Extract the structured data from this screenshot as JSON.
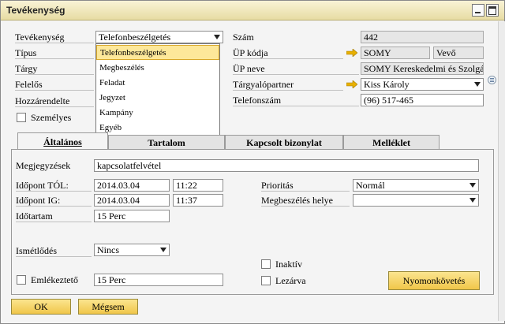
{
  "window": {
    "title": "Tevékenység"
  },
  "left_labels": {
    "tevekenyseg": "Tevékenység",
    "tipus": "Típus",
    "targy": "Tárgy",
    "felelos": "Felelős",
    "hozzarendelte": "Hozzárendelte",
    "szemelyes": "Személyes"
  },
  "activity_select": {
    "value": "Telefonbeszélgetés"
  },
  "activity_options": [
    "Telefonbeszélgetés",
    "Megbeszélés",
    "Feladat",
    "Jegyzet",
    "Kampány",
    "Egyéb"
  ],
  "right_labels": {
    "szam": "Szám",
    "up_kodja": "ÜP kódja",
    "up_neve": "ÜP neve",
    "targyalopartner": "Tárgyalópartner",
    "telefonszam": "Telefonszám"
  },
  "right_values": {
    "szam": "442",
    "up_kodja": "SOMY",
    "up_type": "Vevő",
    "up_neve": "SOMY Kereskedelmi és Szolgál",
    "targyalopartner": "Kiss Károly",
    "telefonszam": "(96) 517-465"
  },
  "tabs": [
    "Általános",
    "Tartalom",
    "Kapcsolt bizonylat",
    "Melléklet"
  ],
  "general": {
    "megjegyzesek_label": "Megjegyzések",
    "megjegyzesek_value": "kapcsolatfelvétel",
    "idopont_tol_label": "Időpont TÓL:",
    "idopont_tol_date": "2014.03.04",
    "idopont_tol_time": "11:22",
    "idopont_ig_label": "Időpont IG:",
    "idopont_ig_date": "2014.03.04",
    "idopont_ig_time": "11:37",
    "idotartam_label": "Időtartam",
    "idotartam_value": "15 Perc",
    "prioritas_label": "Prioritás",
    "prioritas_value": "Normál",
    "megbeszeles_helye_label": "Megbeszélés helye",
    "megbeszeles_helye_value": "",
    "ismetlodes_label": "Ismétlődés",
    "ismetlodes_value": "Nincs",
    "emlekezteto_label": "Emlékeztető",
    "emlekezteto_value": "15 Perc",
    "inaktiv_label": "Inaktív",
    "lezarva_label": "Lezárva",
    "nyomonkovetes_label": "Nyomonkövetés"
  },
  "footer": {
    "ok": "OK",
    "megsem": "Mégsem"
  },
  "colors": {
    "accent": "#f0c64a",
    "title_bar": "#efe6b6",
    "selected_item": "#fde89a",
    "link_arrow": "#e8b000"
  }
}
